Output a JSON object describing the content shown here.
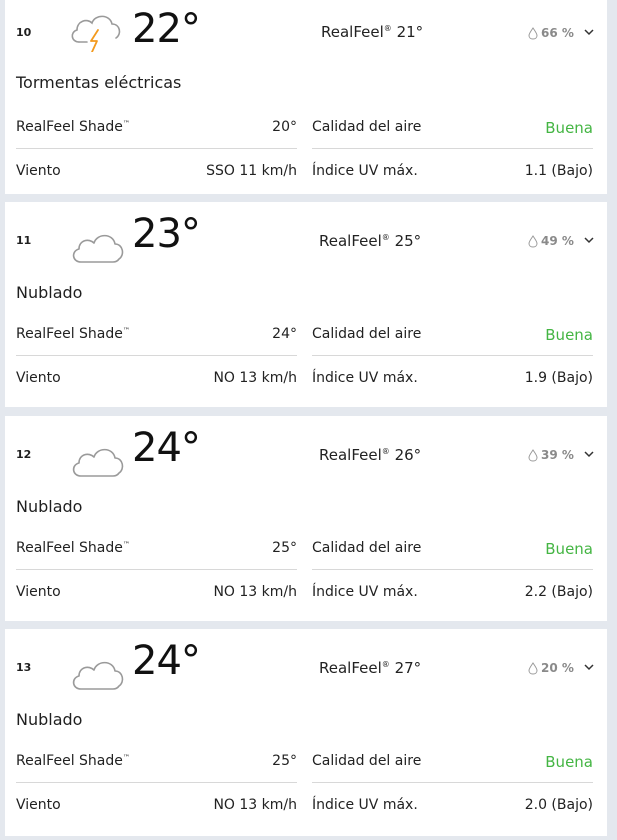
{
  "hours": [
    {
      "hour": "10",
      "icon": "thunderstorm-icon",
      "temp": "22°",
      "realfeel_label": "RealFeel",
      "realfeel_mark": "®",
      "realfeel_value": "21°",
      "precip": "66 %",
      "phrase": "Tormentas eléctricas",
      "shade_label": "RealFeel Shade",
      "shade_mark": "™",
      "shade_value": "20°",
      "air_label": "Calidad del aire",
      "air_value": "Buena",
      "wind_label": "Viento",
      "wind_value": "SSO 11 km/h",
      "uv_label": "Índice UV máx.",
      "uv_value": "1.1 (Bajo)"
    },
    {
      "hour": "11",
      "icon": "cloud-icon",
      "temp": "23°",
      "realfeel_label": "RealFeel",
      "realfeel_mark": "®",
      "realfeel_value": "25°",
      "precip": "49 %",
      "phrase": "Nublado",
      "shade_label": "RealFeel Shade",
      "shade_mark": "™",
      "shade_value": "24°",
      "air_label": "Calidad del aire",
      "air_value": "Buena",
      "wind_label": "Viento",
      "wind_value": "NO 13 km/h",
      "uv_label": "Índice UV máx.",
      "uv_value": "1.9 (Bajo)"
    },
    {
      "hour": "12",
      "icon": "cloud-icon",
      "temp": "24°",
      "realfeel_label": "RealFeel",
      "realfeel_mark": "®",
      "realfeel_value": "26°",
      "precip": "39 %",
      "phrase": "Nublado",
      "shade_label": "RealFeel Shade",
      "shade_mark": "™",
      "shade_value": "25°",
      "air_label": "Calidad del aire",
      "air_value": "Buena",
      "wind_label": "Viento",
      "wind_value": "NO 13 km/h",
      "uv_label": "Índice UV máx.",
      "uv_value": "2.2 (Bajo)"
    },
    {
      "hour": "13",
      "icon": "cloud-icon",
      "temp": "24°",
      "realfeel_label": "RealFeel",
      "realfeel_mark": "®",
      "realfeel_value": "27°",
      "precip": "20 %",
      "phrase": "Nublado",
      "shade_label": "RealFeel Shade",
      "shade_mark": "™",
      "shade_value": "25°",
      "air_label": "Calidad del aire",
      "air_value": "Buena",
      "wind_label": "Viento",
      "wind_value": "NO 13 km/h",
      "uv_label": "Índice UV máx.",
      "uv_value": "2.0 (Bajo)"
    }
  ],
  "colors": {
    "air_good": "#44b543",
    "lightning": "#f39a1e",
    "cloud_stroke": "#9a9a9a",
    "precip_text": "#8a8a8a"
  }
}
